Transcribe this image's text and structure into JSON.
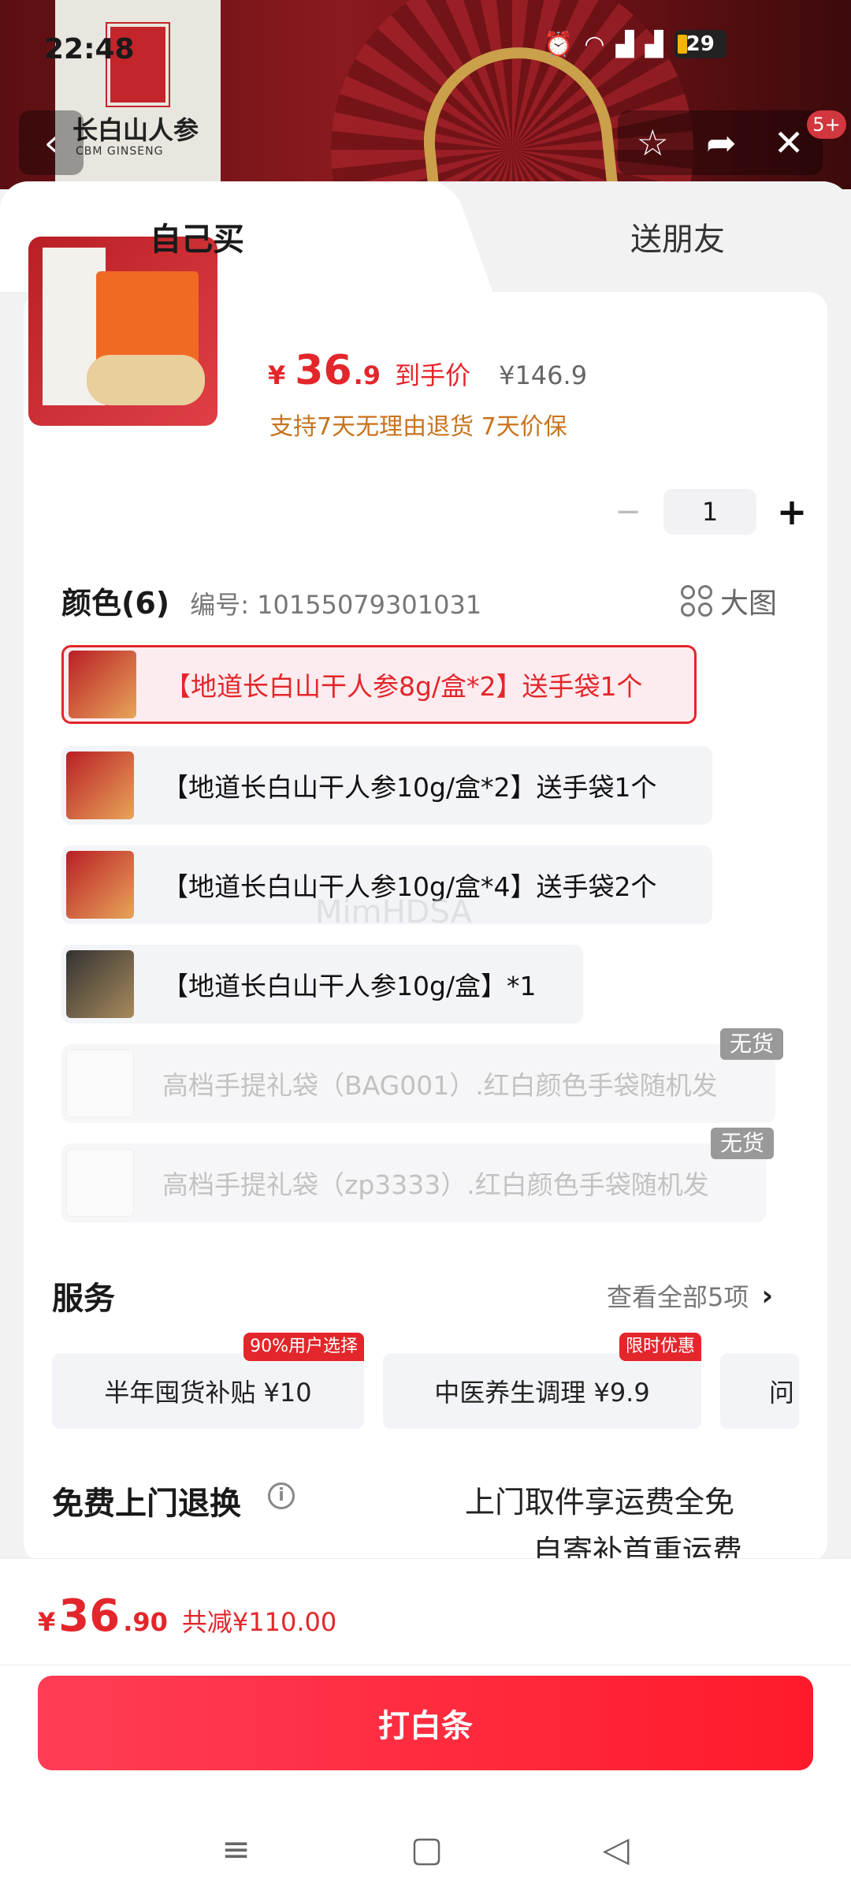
{
  "status": {
    "time": "22:48",
    "battery": "29",
    "icons": [
      "alarm-icon",
      "wifi-icon",
      "signal-icon",
      "signal-icon",
      "battery-icon"
    ]
  },
  "store": {
    "brand": "长白山人参",
    "brand_en": "CBM GINSENG"
  },
  "topnav": {
    "badge": "5+"
  },
  "tabs": {
    "self": "自己买",
    "friend": "送朋友"
  },
  "product": {
    "price_symbol": "¥",
    "price_int": "36",
    "price_dec": ".9",
    "price_label": "到手价",
    "price_original": "¥146.9",
    "promo": "支持7天无理由退货 7天价保",
    "quantity": "1"
  },
  "color": {
    "title": "颜色(6)",
    "code": "编号: 10155079301031",
    "big_image_label": "大图",
    "options": [
      {
        "label": "【地道长白山干人参8g/盒*2】送手袋1个",
        "state": "selected"
      },
      {
        "label": "【地道长白山干人参10g/盒*2】送手袋1个",
        "state": "normal"
      },
      {
        "label": "【地道长白山干人参10g/盒*4】送手袋2个",
        "state": "normal"
      },
      {
        "label": "【地道长白山干人参10g/盒】*1",
        "state": "normal"
      },
      {
        "label": "高档手提礼袋（BAG001）.红白颜色手袋随机发",
        "state": "out_of_stock",
        "badge": "无货"
      },
      {
        "label": "高档手提礼袋（zp3333）.红白颜色手袋随机发",
        "state": "out_of_stock",
        "badge": "无货"
      }
    ]
  },
  "watermark": "MimHDSA",
  "services": {
    "title": "服务",
    "more": "查看全部5项",
    "items": [
      {
        "label": "半年囤货补贴  ¥10",
        "tag": "90%用户选择"
      },
      {
        "label": "中医养生调理  ¥9.9",
        "tag": "限时优惠"
      },
      {
        "label": "问"
      }
    ]
  },
  "returns": {
    "title": "免费上门退换",
    "desc1": "上门取件享运费全免",
    "desc2": "自寄补首重运费"
  },
  "footer": {
    "symbol": "¥",
    "int": "36",
    "dec": ".90",
    "saved": "共减¥110.00",
    "pay_label": "打白条"
  },
  "colors": {
    "accent": "#e3262b",
    "promo": "#c8731c"
  }
}
